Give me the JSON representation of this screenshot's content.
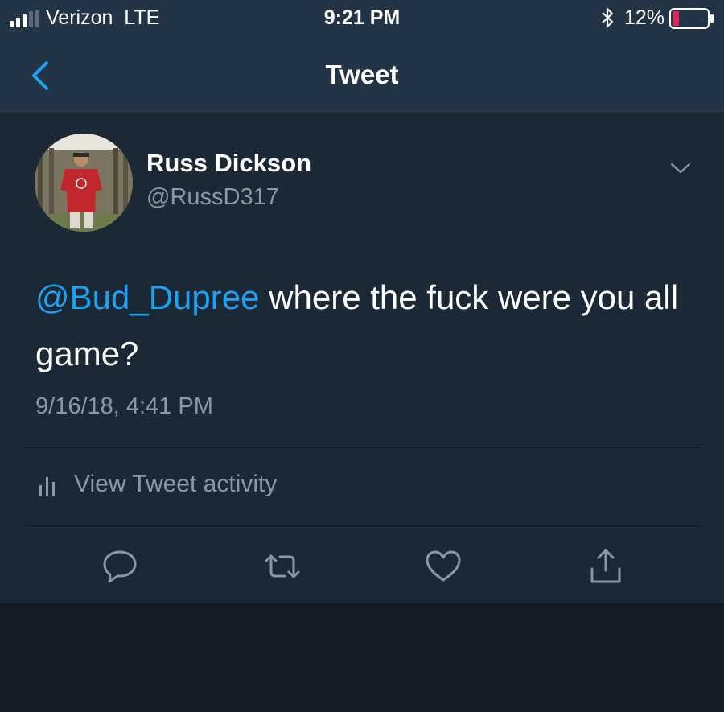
{
  "status_bar": {
    "carrier": "Verizon",
    "network": "LTE",
    "time": "9:21 PM",
    "battery_percent": "12%",
    "icons": [
      "signal-icon",
      "bluetooth-icon",
      "battery-icon"
    ]
  },
  "nav": {
    "title": "Tweet",
    "back_icon": "back-chevron-icon"
  },
  "tweet": {
    "author_name": "Russ Dickson",
    "author_handle": "@RussD317",
    "mention": "@Bud_Dupree",
    "text": " where the fuck were you all game?",
    "timestamp": "9/16/18, 4:41 PM",
    "activity_label": "View Tweet activity",
    "actions": [
      "reply-icon",
      "retweet-icon",
      "like-icon",
      "share-icon"
    ]
  },
  "colors": {
    "header_bg": "#243447",
    "card_bg": "#1b2836",
    "page_bg": "#141d26",
    "accent": "#1da1f2",
    "secondary_text": "#8899a6",
    "battery_low": "#e0245e"
  }
}
